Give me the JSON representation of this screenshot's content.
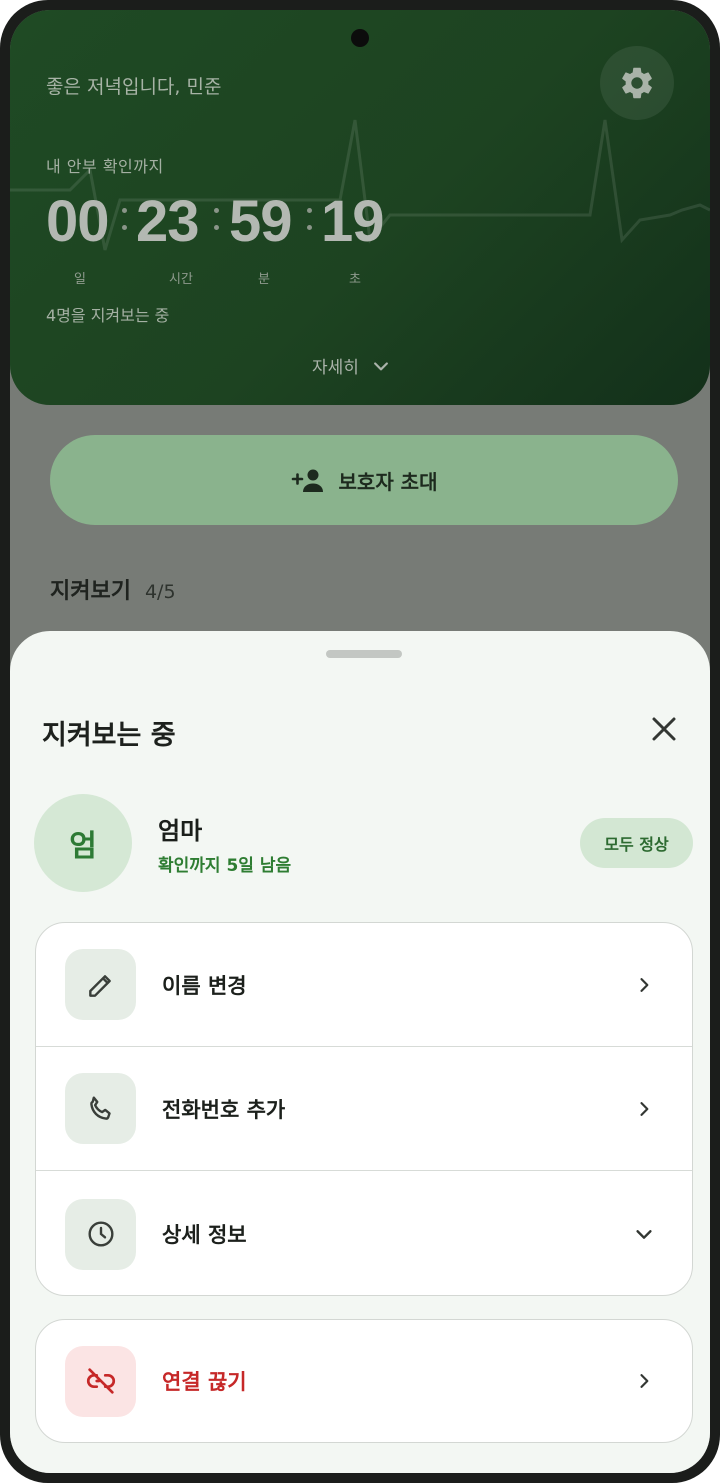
{
  "header": {
    "greeting": "좋은 저녁입니다, 민준",
    "countdown_label": "내 안부 확인까지",
    "countdown": {
      "days": "00",
      "hours": "23",
      "minutes": "59",
      "seconds": "19",
      "units": {
        "days": "일",
        "hours": "시간",
        "minutes": "분",
        "seconds": "초"
      }
    },
    "watching_count_text": "4명을 지켜보는 중",
    "details_toggle": "자세히",
    "settings_icon": "gear-icon"
  },
  "invite_button": {
    "label": "보호자 초대",
    "icon": "person-add-icon"
  },
  "watch_section": {
    "title": "지켜보기",
    "count": "4/5"
  },
  "sheet": {
    "title": "지켜보는 중",
    "person": {
      "avatar_initial": "엄",
      "name": "엄마",
      "status": "확인까지 5일 남음",
      "badge": "모두 정상"
    },
    "menu": [
      {
        "label": "이름 변경",
        "icon": "pencil-icon",
        "chevron": "chevron-right-icon"
      },
      {
        "label": "전화번호 추가",
        "icon": "phone-icon",
        "chevron": "chevron-right-icon"
      },
      {
        "label": "상세 정보",
        "icon": "clock-icon",
        "chevron": "chevron-down-icon"
      }
    ],
    "danger_action": {
      "label": "연결 끊기",
      "icon": "link-off-icon",
      "chevron": "chevron-right-icon"
    }
  },
  "colors": {
    "hero_green": "#1f4a24",
    "accent_green": "#2e7d32",
    "danger_red": "#c62828",
    "sheet_bg": "#f3f7f3"
  }
}
